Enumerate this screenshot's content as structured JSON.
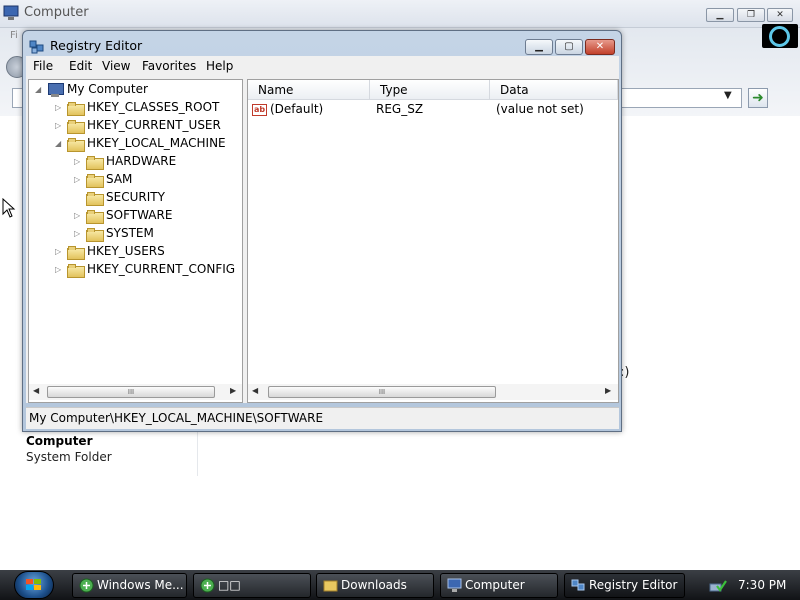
{
  "background_window": {
    "title": "Computer",
    "menu_hint": "Fi",
    "stray_text": ":)",
    "details": {
      "name": "Computer",
      "type": "System Folder"
    }
  },
  "registry_editor": {
    "title": "Registry Editor",
    "menu": [
      "File",
      "Edit",
      "View",
      "Favorites",
      "Help"
    ],
    "tree": {
      "root": "My Computer",
      "hives": [
        {
          "label": "HKEY_CLASSES_ROOT"
        },
        {
          "label": "HKEY_CURRENT_USER"
        },
        {
          "label": "HKEY_LOCAL_MACHINE",
          "children": [
            "HARDWARE",
            "SAM",
            "SECURITY",
            "SOFTWARE",
            "SYSTEM"
          ]
        },
        {
          "label": "HKEY_USERS"
        },
        {
          "label": "HKEY_CURRENT_CONFIG"
        }
      ]
    },
    "columns": [
      "Name",
      "Type",
      "Data"
    ],
    "values": [
      {
        "name": "(Default)",
        "type": "REG_SZ",
        "data": "(value not set)"
      }
    ],
    "scroll_thumb": "III",
    "status": "My Computer\\HKEY_LOCAL_MACHINE\\SOFTWARE"
  },
  "taskbar": {
    "items": [
      {
        "label": "Windows Me...",
        "icon": "ie-icon"
      },
      {
        "label": "□□",
        "icon": "ie-icon"
      },
      {
        "label": "Downloads",
        "icon": "folder-icon"
      },
      {
        "label": "Computer",
        "icon": "computer-icon"
      },
      {
        "label": "Registry Editor",
        "icon": "regedit-icon",
        "active": true
      }
    ],
    "clock": "7:30 PM"
  },
  "colors": {
    "taskbar": "#1e2126",
    "close_button": "#c2402b",
    "folder": "#e2c25c"
  }
}
